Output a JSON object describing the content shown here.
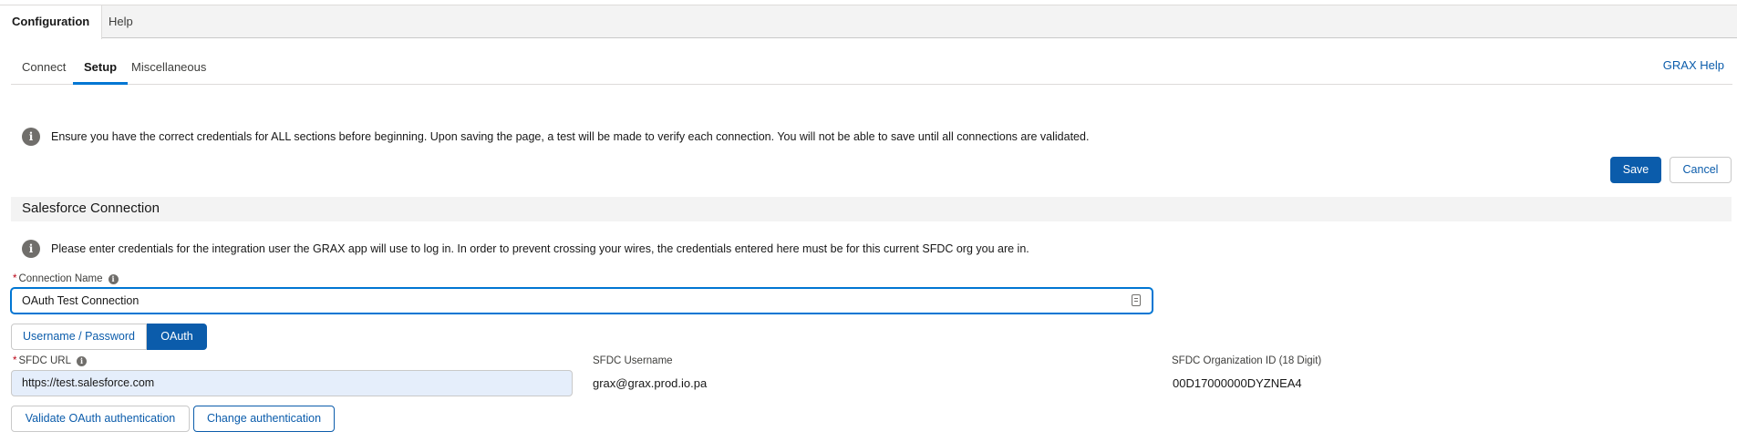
{
  "top_tabs": {
    "configuration": "Configuration",
    "help": "Help"
  },
  "sub_tabs": {
    "connect": "Connect",
    "setup": "Setup",
    "miscellaneous": "Miscellaneous"
  },
  "grax_help_link": "GRAX Help",
  "info_banner": {
    "icon": "info-icon",
    "text": "Ensure you have the correct credentials for ALL sections before beginning. Upon saving the page, a test will be made to verify each connection. You will not be able to save until all connections are validated."
  },
  "actions": {
    "save": "Save",
    "cancel": "Cancel"
  },
  "salesforce_section": {
    "title": "Salesforce Connection",
    "info_text": "Please enter credentials for the integration user the GRAX app will use to log in. In order to prevent crossing your wires, the credentials entered here must be for this current SFDC org you are in.",
    "connection_name": {
      "required_marker": "*",
      "label": "Connection Name",
      "value": "OAuth Test Connection"
    },
    "auth_toggle": {
      "username_password": "Username / Password",
      "oauth": "OAuth",
      "selected": "OAuth"
    },
    "sfdc_url": {
      "required_marker": "*",
      "label": "SFDC URL",
      "value": "https://test.salesforce.com"
    },
    "sfdc_username": {
      "label": "SFDC Username",
      "value": "grax@grax.prod.io.pa"
    },
    "sfdc_org_id": {
      "label": "SFDC Organization ID (18 Digit)",
      "value": "00D17000000DYZNEA4"
    },
    "validate_button": "Validate OAuth authentication",
    "change_auth_button": "Change authentication"
  },
  "colors": {
    "brand": "#0b5cab",
    "active_tab_underline": "#0176d3",
    "required": "#ba0517",
    "section_bg": "#f3f3f3"
  }
}
